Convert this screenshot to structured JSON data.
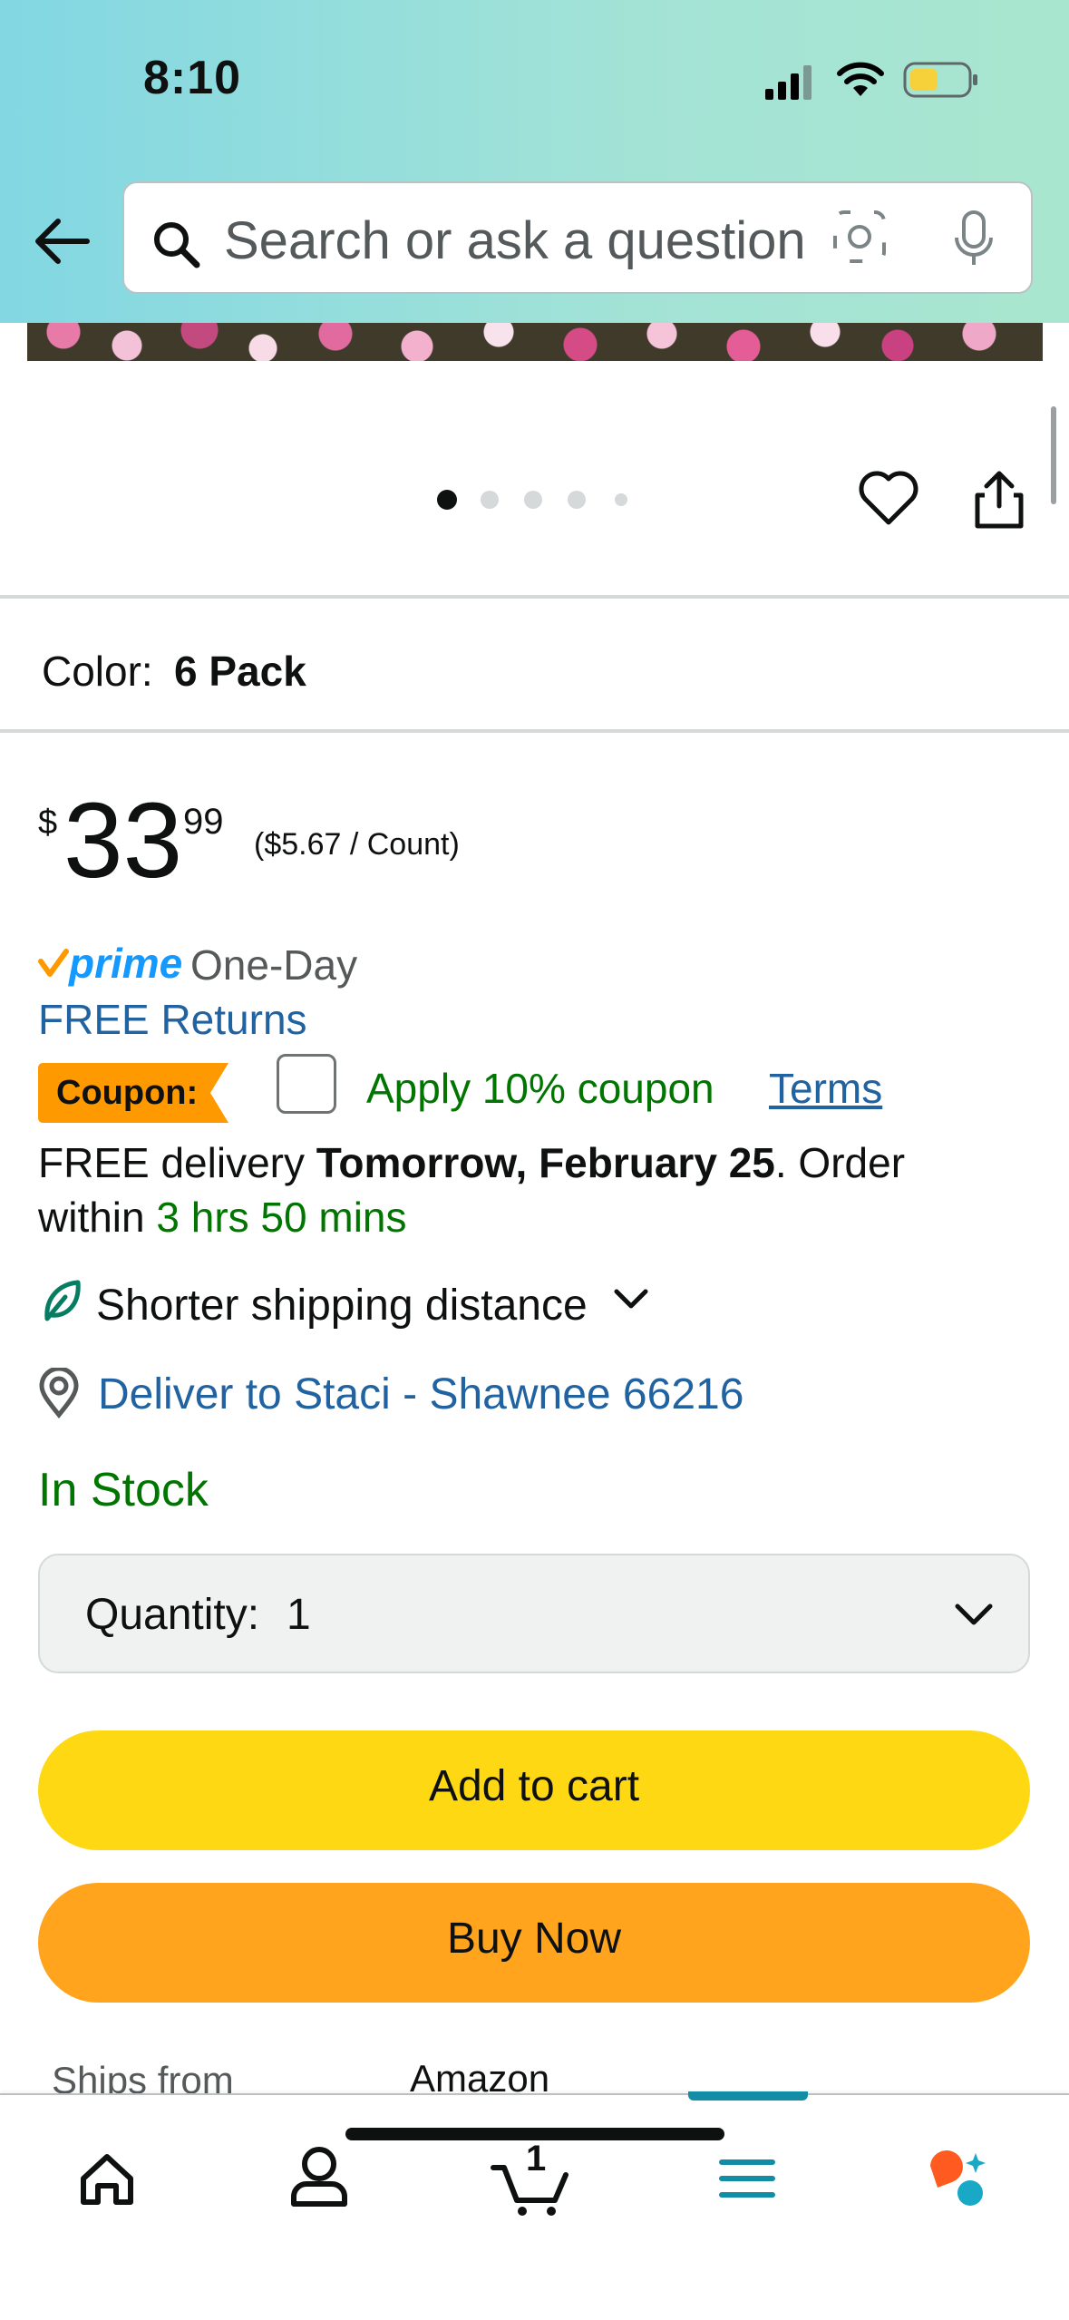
{
  "status_bar": {
    "time": "8:10"
  },
  "search": {
    "placeholder": "Search or ask a question"
  },
  "product": {
    "color_label": "Color:",
    "color_value": "6 Pack",
    "price": {
      "symbol": "$",
      "whole": "33",
      "fraction": "99",
      "per_unit": "($5.67 / Count)"
    },
    "prime": {
      "word": "prime",
      "speed": "One-Day"
    },
    "free_returns": "FREE Returns",
    "coupon": {
      "label": "Coupon:",
      "apply": "Apply 10% coupon",
      "terms": "Terms",
      "checked": false
    },
    "delivery": {
      "prefix": "FREE delivery ",
      "date": "Tomorrow, February 25",
      "middle": ". Order",
      "within": "within ",
      "countdown": "3 hrs 50 mins"
    },
    "shipping_distance": "Shorter shipping distance",
    "deliver_to": "Deliver to Staci - Shawnee 66216",
    "stock": "In Stock",
    "quantity": {
      "label": "Quantity:",
      "value": "1"
    },
    "add_to_cart": "Add to cart",
    "buy_now": "Buy Now",
    "ships_from": {
      "label": "Ships from",
      "value": "Amazon"
    }
  },
  "image_pager": {
    "count": 5,
    "active_index": 0
  },
  "tabbar": {
    "cart_count": "1",
    "tabs": [
      "home",
      "account",
      "cart",
      "menu",
      "rufus"
    ],
    "active_tab": "menu"
  },
  "colors": {
    "link": "#2162a1",
    "success": "#007600",
    "add_to_cart": "#ffd814",
    "buy_now": "#ffa41c",
    "coupon_badge": "#ff9900",
    "tab_active": "#138da6"
  }
}
